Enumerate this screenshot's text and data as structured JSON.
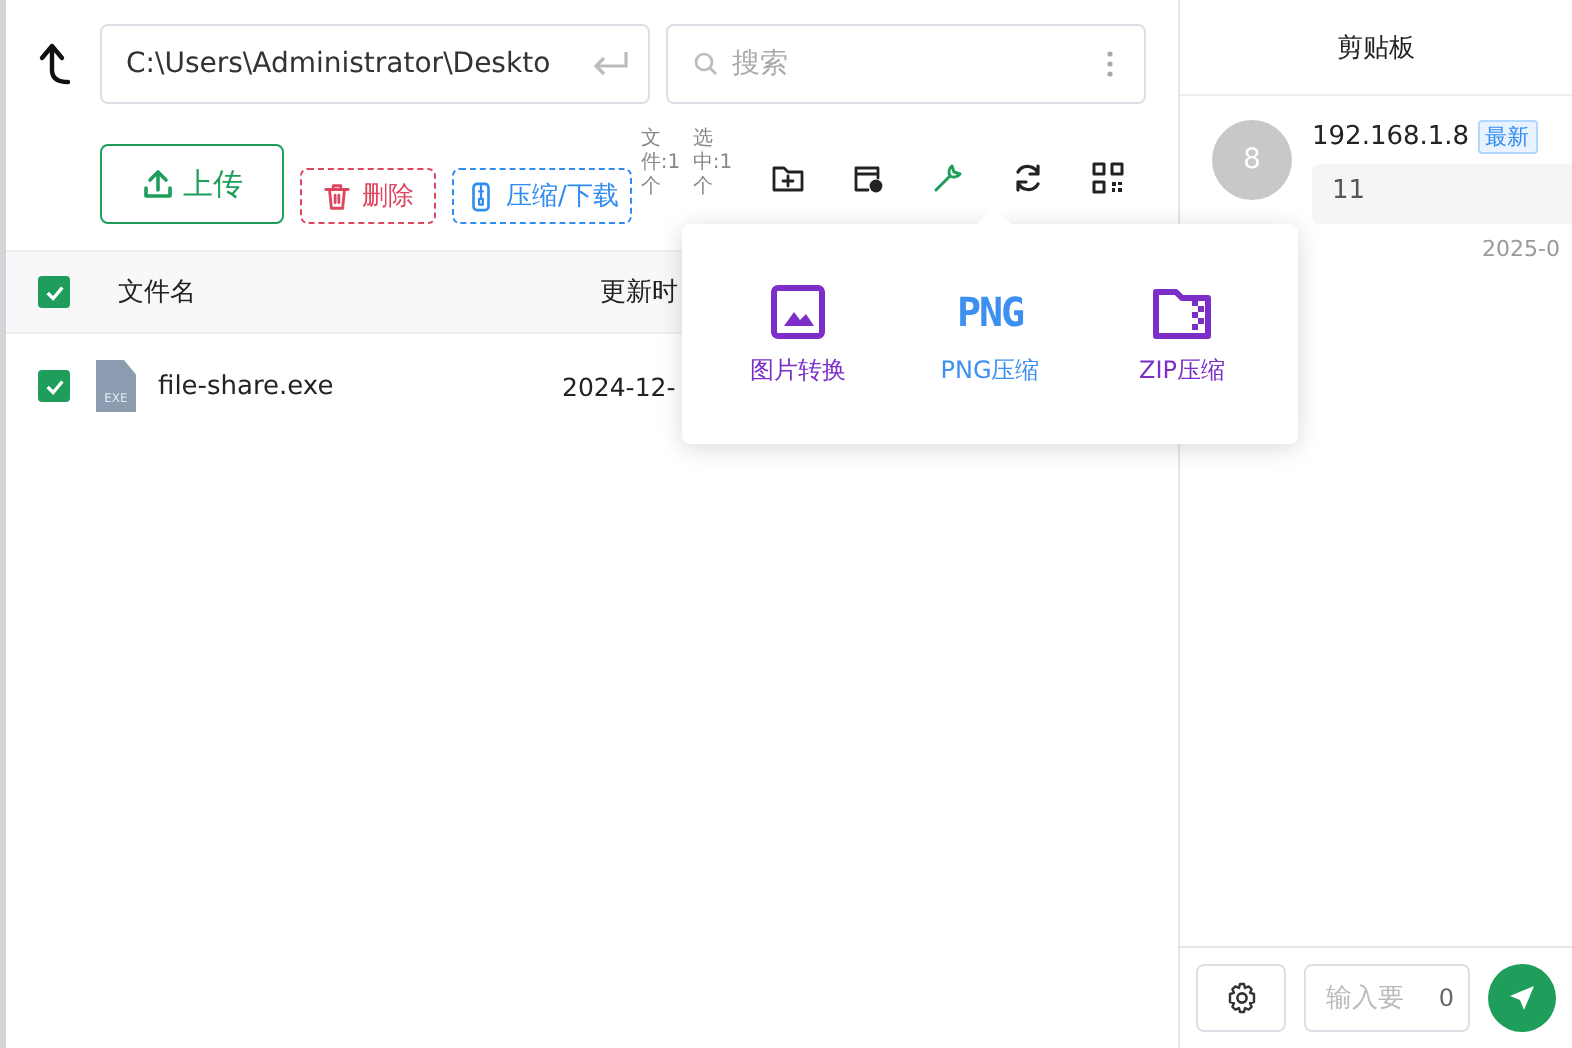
{
  "toolbar": {
    "path": "C:\\Users\\Administrator\\Deskto",
    "search_placeholder": "搜索",
    "buttons": [
      {
        "kind": "upload",
        "label": "上传"
      },
      {
        "kind": "delete",
        "label": "删除"
      },
      {
        "kind": "compress",
        "label": "压缩/下载"
      }
    ],
    "counts": [
      "文件:1个",
      "选中:1个"
    ],
    "tools": [
      {
        "kind": "new-folder",
        "selected": false
      },
      {
        "kind": "disk-sync",
        "selected": false
      },
      {
        "kind": "wrench",
        "selected": true
      },
      {
        "kind": "refresh",
        "selected": false
      },
      {
        "kind": "qrcode",
        "selected": false
      }
    ]
  },
  "table": {
    "all_checked": true,
    "columns": [
      "文件名",
      "更新时"
    ],
    "rows": [
      {
        "checked": true,
        "type_label": "EXE",
        "name": "file-share.exe",
        "updated": "2024-12-"
      }
    ]
  },
  "tool_menu": [
    {
      "kind": "image",
      "label": "图片转换"
    },
    {
      "kind": "png",
      "mark": "PNG",
      "label": "PNG压缩"
    },
    {
      "kind": "zip",
      "label": "ZIP压缩"
    }
  ],
  "clipboard": {
    "title": "剪贴板",
    "messages": [
      {
        "avatar": "8",
        "sender": "192.168.1.8",
        "tag": "最新",
        "text": "11",
        "time": "2025-0"
      }
    ],
    "input_placeholder": "输入要",
    "count": "0"
  }
}
